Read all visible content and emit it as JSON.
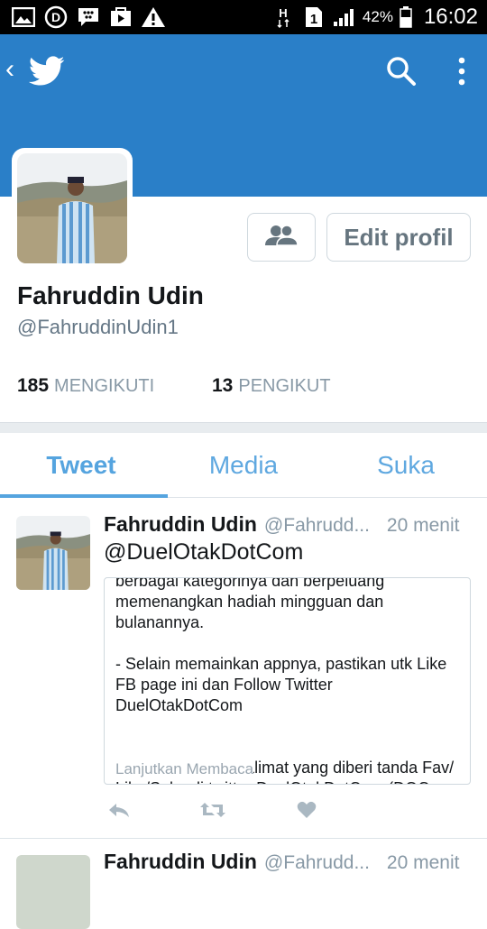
{
  "status_bar": {
    "battery": "42%",
    "time": "16:02",
    "icons": [
      "gallery-icon",
      "d-app-icon",
      "bbm-icon",
      "play-store-icon",
      "warning-icon",
      "h-network-icon",
      "sim1-icon",
      "signal-icon",
      "battery-icon"
    ]
  },
  "header": {
    "back_icon": "chevron-left-icon",
    "logo": "twitter-bird-icon",
    "search_icon": "search-icon",
    "more_icon": "more-vertical-icon"
  },
  "colors": {
    "header_blue": "#2a7fc8",
    "tab_blue": "#55a4df",
    "text_dark": "#14171a",
    "text_grey": "#8899a6"
  },
  "profile": {
    "name": "Fahruddin Udin",
    "handle": "@FahruddinUdin1",
    "edit_button": "Edit profil",
    "friends_icon": "people-icon",
    "following_count": "185",
    "following_label": "MENGIKUTI",
    "followers_count": "13",
    "followers_label": "PENGIKUT"
  },
  "tabs": [
    {
      "label": "Tweet",
      "active": true
    },
    {
      "label": "Media",
      "active": false
    },
    {
      "label": "Suka",
      "active": false
    }
  ],
  "tweet": {
    "name": "Fahruddin Udin",
    "handle": "@Fahrudd...",
    "time": "20 menit",
    "text": "@DuelOtakDotCom",
    "card_lines": "berbagai kategorinya dan berpeluang\nmemenangkan hadiah mingguan dan\nbulanannya.\n\n- Selain memainkan appnya, pastikan utk Like\nFB page ini dan Follow Twitter DuelOtakDotCom\n\n\n- Retweet setiap kalimat yang diberi tanda Fav/\nLike/Suka di twitter DuelOtakDotCom (DOC...",
    "card_more": "Lanjutkan Membaca",
    "actions": [
      "reply-icon",
      "retweet-icon",
      "like-icon"
    ]
  },
  "tweet2": {
    "name": "Fahruddin Udin",
    "handle": "@Fahrudd...",
    "time": "20 menit"
  }
}
